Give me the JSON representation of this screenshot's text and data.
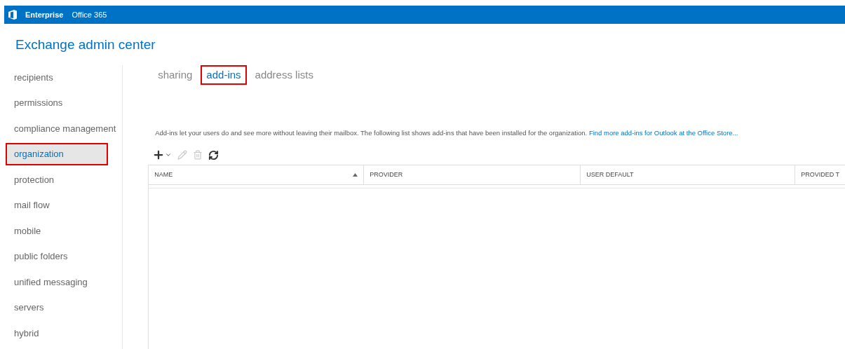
{
  "top_bar": {
    "items": [
      {
        "label": "Enterprise",
        "selected": true
      },
      {
        "label": "Office 365",
        "selected": false
      }
    ]
  },
  "app_title": "Exchange admin center",
  "sidebar": {
    "items": [
      {
        "label": "recipients",
        "selected": false,
        "highlighted": false
      },
      {
        "label": "permissions",
        "selected": false,
        "highlighted": false
      },
      {
        "label": "compliance management",
        "selected": false,
        "highlighted": false
      },
      {
        "label": "organization",
        "selected": true,
        "highlighted": true
      },
      {
        "label": "protection",
        "selected": false,
        "highlighted": false
      },
      {
        "label": "mail flow",
        "selected": false,
        "highlighted": false
      },
      {
        "label": "mobile",
        "selected": false,
        "highlighted": false
      },
      {
        "label": "public folders",
        "selected": false,
        "highlighted": false
      },
      {
        "label": "unified messaging",
        "selected": false,
        "highlighted": false
      },
      {
        "label": "servers",
        "selected": false,
        "highlighted": false
      },
      {
        "label": "hybrid",
        "selected": false,
        "highlighted": false
      }
    ]
  },
  "tabs": [
    {
      "label": "sharing",
      "selected": false,
      "highlighted": false
    },
    {
      "label": "add-ins",
      "selected": true,
      "highlighted": true
    },
    {
      "label": "address lists",
      "selected": false,
      "highlighted": false
    }
  ],
  "description": "Add-ins let your users do and see more without leaving their mailbox. The following list shows add-ins that have been installed for the organization.",
  "description_link": "Find more add-ins for Outlook at the Office Store...",
  "toolbar": [
    {
      "kind": "add",
      "disabled": false
    },
    {
      "kind": "edit",
      "disabled": true
    },
    {
      "kind": "delete",
      "disabled": true
    },
    {
      "kind": "refresh",
      "disabled": false
    }
  ],
  "table": {
    "columns": [
      {
        "label": "NAME",
        "sorted": true
      },
      {
        "label": "PROVIDER",
        "sorted": false
      },
      {
        "label": "USER DEFAULT",
        "sorted": false
      },
      {
        "label": "PROVIDED T",
        "sorted": false
      }
    ]
  }
}
